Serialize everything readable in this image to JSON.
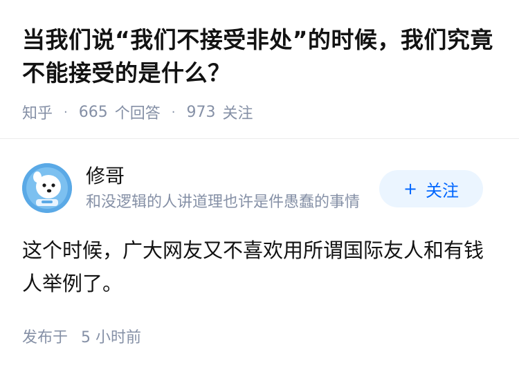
{
  "question": {
    "title": "当我们说“我们不接受非处”的时候，我们究竟不能接受的是什么？",
    "source": "知乎",
    "answer_count": "665",
    "answer_count_label": "个回答",
    "follower_count": "973",
    "follower_label": "关注"
  },
  "author": {
    "name": "修哥",
    "bio": "和没逻辑的人讲道理也许是件愚蠢的事情",
    "avatar_icon": "cartoon-avatar-icon",
    "follow_label": "关注",
    "follow_icon": "plus-icon"
  },
  "answer": {
    "text": "这个时候，广大网友又不喜欢用所谓国际友人和有钱人举例了。",
    "time_label": "发布于",
    "time_value": "5 小时前"
  },
  "colors": {
    "accent": "#0066ff",
    "accent_bg": "#ebf5ff",
    "meta_text": "#8590a6",
    "avatar_bg": "#5aa9e6"
  }
}
